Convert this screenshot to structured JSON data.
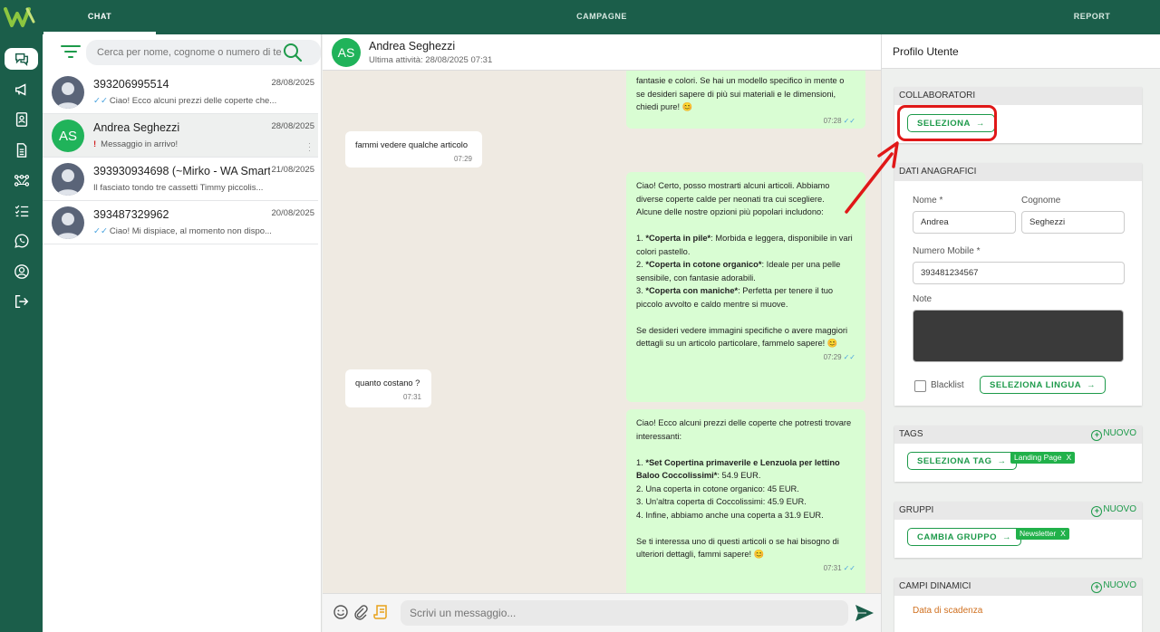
{
  "nav": {
    "tabs": [
      "CHAT",
      "CAMPAGNE",
      "REPORT"
    ]
  },
  "search": {
    "placeholder": "Cerca per nome, cognome o numero di te"
  },
  "conversations": [
    {
      "name": "393206995514",
      "date": "28/08/2025",
      "preview": "Ciao! Ecco alcuni prezzi delle coperte che...",
      "status": "read"
    },
    {
      "name": "Andrea Seghezzi",
      "initials": "AS",
      "date": "28/08/2025",
      "preview": "Messaggio in arrivo!",
      "status": "alert"
    },
    {
      "name": "393930934698 (~Mirko - WA Smart...",
      "date": "21/08/2025",
      "preview": "Il fasciato tondo tre cassetti Timmy piccolis...",
      "status": "none"
    },
    {
      "name": "393487329962",
      "date": "20/08/2025",
      "preview": "Ciao! Mi dispiace, al momento non dispo...",
      "status": "read"
    }
  ],
  "chat": {
    "name": "Andrea Seghezzi",
    "initials": "AS",
    "status": "Ultima attività: 28/08/2025 07:31",
    "messages": [
      {
        "dir": "out",
        "text": "fantasie e colori. Se hai un modello specifico in mente o\nse desideri sapere di più sui materiali e le dimensioni,\nchiedi pure! 😊",
        "time": "07:28"
      },
      {
        "dir": "in",
        "text": "fammi vedere qualche articolo",
        "time": "07:29"
      },
      {
        "dir": "out",
        "text": "Ciao! Certo, posso mostrarti alcuni articoli. Abbiamo\ndiverse coperte calde per neonati tra cui scegliere.\nAlcune delle nostre opzioni più popolari includono:\n\n1. *Coperta in pile*: Morbida e leggera, disponibile in vari\ncolori pastello.\n2. *Coperta in cotone organico*: Ideale per una pelle\nsensibile, con fantasie adorabili.\n3. *Coperta con maniche*: Perfetta per tenere il tuo\npiccolo avvolto e caldo mentre si muove.\n\nSe desideri vedere immagini specifiche o avere maggiori\ndettagli su un articolo particolare, fammelo sapere! 😊",
        "time": "07:29"
      },
      {
        "dir": "in",
        "text": "quanto costano ?",
        "time": "07:31"
      },
      {
        "dir": "out",
        "text": "Ciao! Ecco alcuni prezzi delle coperte che potresti trovare\ninteressanti:\n\n1. *Set Copertina primaverile e Lenzuola per lettino\nBaloo Coccolissimi*: 54.9 EUR.\n2. Una coperta in cotone organico: 45 EUR.\n3. Un'altra coperta di Coccolissimi: 45.9 EUR.\n4. Infine, abbiamo anche una coperta a 31.9 EUR.\n\nSe ti interessa uno di questi articoli o se hai bisogno di\nulteriori dettagli, fammi sapere! 😊",
        "time": "07:31"
      }
    ],
    "composer_placeholder": "Scrivi un messaggio..."
  },
  "profile": {
    "title": "Profilo Utente",
    "collaboratori": {
      "header": "COLLABORATORI",
      "button": "SELEZIONA"
    },
    "anagrafici": {
      "header": "DATI ANAGRAFICI",
      "nome_label": "Nome *",
      "nome_value": "Andrea",
      "cognome_label": "Cognome",
      "cognome_value": "Seghezzi",
      "mobile_label": "Numero Mobile *",
      "mobile_value": "393481234567",
      "note_label": "Note",
      "blacklist_label": "Blacklist",
      "lingua_button": "SELEZIONA LINGUA"
    },
    "tags": {
      "header": "TAGS",
      "new": "NUOVO",
      "button": "SELEZIONA TAG",
      "chip": "Landing Page",
      "chip_x": "X"
    },
    "gruppi": {
      "header": "GRUPPI",
      "new": "NUOVO",
      "button": "CAMBIA GRUPPO",
      "chip": "Newsletter",
      "chip_x": "X"
    },
    "campi": {
      "header": "CAMPI DINAMICI",
      "new": "NUOVO",
      "field_label": "Data di scadenza"
    }
  },
  "colors": {
    "brand": "#1b5e4a",
    "accent": "#1d9a4a",
    "outgoing": "#d9fdd3",
    "highlight": "#e01818"
  }
}
